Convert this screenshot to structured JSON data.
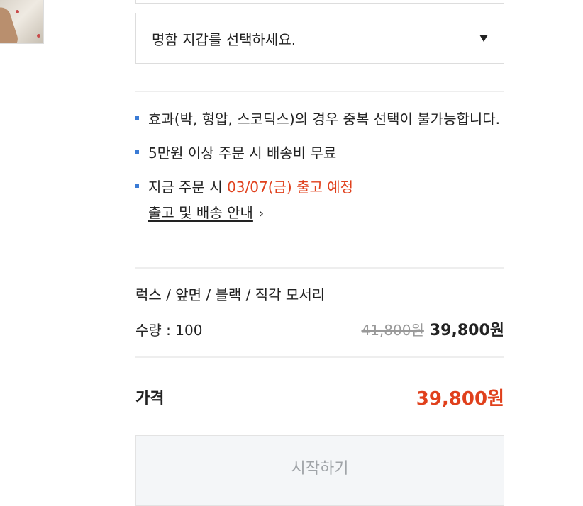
{
  "thumbnail": {
    "icon": "product-thumbnail-image"
  },
  "wallet_select": {
    "placeholder": "명함 지갑를 선택하세요.",
    "icon": "triangle-down-icon"
  },
  "notices": [
    {
      "text": "효과(박, 형압, 스코딕스)의 경우 중복 선택이 불가능합니다."
    },
    {
      "text": "5만원 이상 주문 시 배송비 무료"
    },
    {
      "prefix": "지금 주문 시 ",
      "highlight": "03/07(금) 출고 예정",
      "link": "출고 및 배송 안내",
      "link_icon": "chevron-right-icon"
    }
  ],
  "colors": {
    "accent_red": "#e0401c",
    "bullet_blue": "#3a7bd5"
  },
  "order_summary": {
    "option": "럭스 / 앞면 / 블랙 / 직각 모서리",
    "quantity": "수량 : 100",
    "original_price": "41,800원",
    "sale_price": "39,800원"
  },
  "total": {
    "label": "가격",
    "price": "39,800원"
  },
  "start_button": {
    "label": "시작하기"
  }
}
